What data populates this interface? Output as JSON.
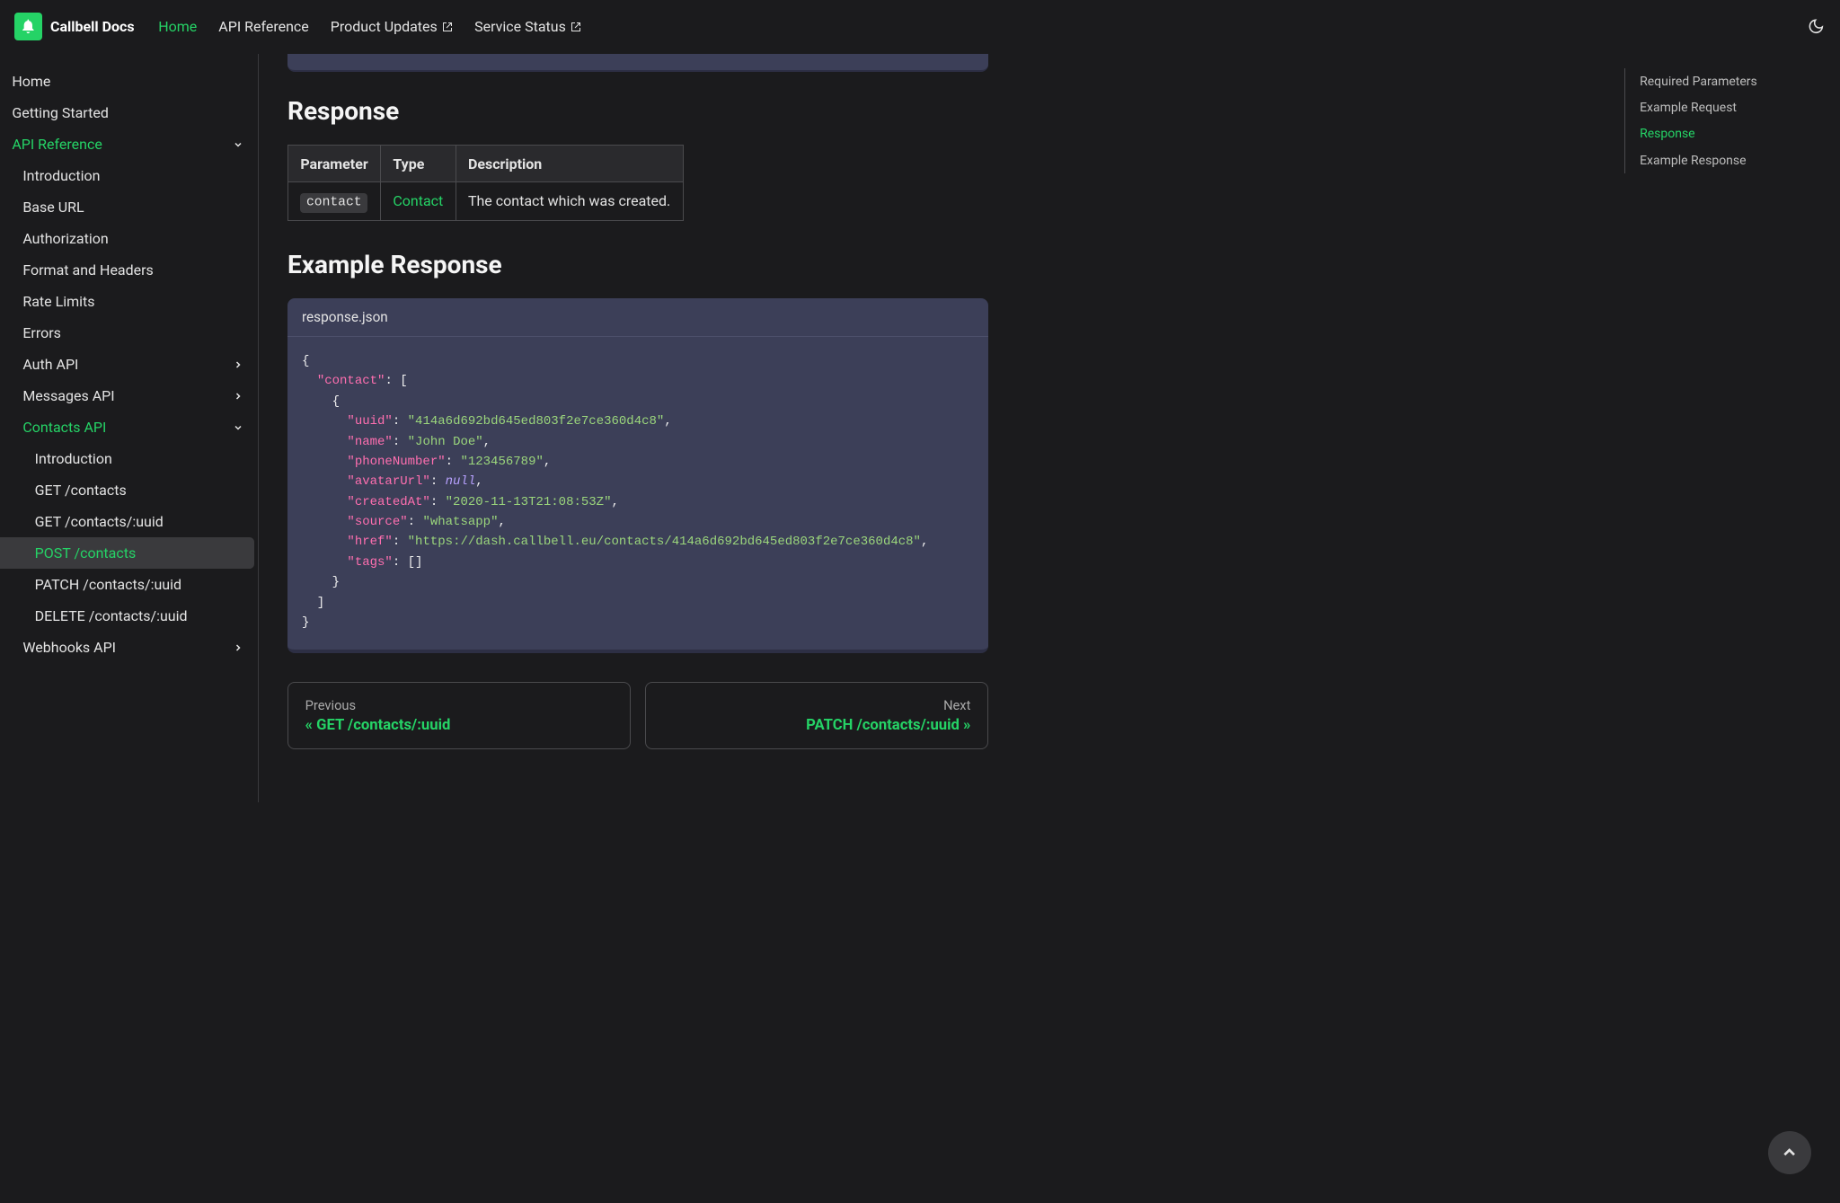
{
  "brand": "Callbell Docs",
  "nav": {
    "home": "Home",
    "api_ref": "API Reference",
    "product_updates": "Product Updates",
    "service_status": "Service Status"
  },
  "sidebar": {
    "home": "Home",
    "getting_started": "Getting Started",
    "api_reference": "API Reference",
    "introduction": "Introduction",
    "base_url": "Base URL",
    "authorization": "Authorization",
    "format_headers": "Format and Headers",
    "rate_limits": "Rate Limits",
    "errors": "Errors",
    "auth_api": "Auth API",
    "messages_api": "Messages API",
    "contacts_api": "Contacts API",
    "contacts_intro": "Introduction",
    "get_contacts": "GET /contacts",
    "get_contact_uuid": "GET /contacts/:uuid",
    "post_contacts": "POST /contacts",
    "patch_contact_uuid": "PATCH /contacts/:uuid",
    "delete_contact_uuid": "DELETE /contacts/:uuid",
    "webhooks_api": "Webhooks API"
  },
  "toc": {
    "required_params": "Required Parameters",
    "example_request": "Example Request",
    "response": "Response",
    "example_response": "Example Response"
  },
  "sections": {
    "response": "Response",
    "example_response": "Example Response"
  },
  "table": {
    "headers": {
      "parameter": "Parameter",
      "type": "Type",
      "description": "Description"
    },
    "row": {
      "param": "contact",
      "type": "Contact",
      "desc": "The contact which was created."
    }
  },
  "code": {
    "filename": "response.json",
    "uuid": "\"414a6d692bd645ed803f2e7ce360d4c8\"",
    "name": "\"John Doe\"",
    "phone": "\"123456789\"",
    "created": "\"2020-11-13T21:08:53Z\"",
    "source": "\"whatsapp\"",
    "href": "\"https://dash.callbell.eu/contacts/414a6d692bd645ed803f2e7ce360d4c8\""
  },
  "pager": {
    "prev_label": "Previous",
    "prev_title": "« GET /contacts/:uuid",
    "next_label": "Next",
    "next_title": "PATCH /contacts/:uuid »"
  }
}
